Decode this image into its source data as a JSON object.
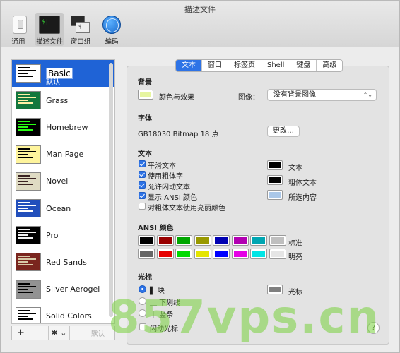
{
  "window": {
    "title": "描述文件"
  },
  "toolbar": {
    "items": [
      {
        "label": "通用",
        "icon": "general-icon"
      },
      {
        "label": "描述文件",
        "icon": "profiles-icon",
        "active": true
      },
      {
        "label": "窗口组",
        "icon": "window-groups-icon"
      },
      {
        "label": "编码",
        "icon": "encoding-icon"
      }
    ]
  },
  "profiles": {
    "items": [
      {
        "name": "Basic",
        "sub": "默认",
        "selected": true,
        "bg": "#ffffff",
        "fg": "#000000"
      },
      {
        "name": "Grass",
        "bg": "#13773d",
        "fg": "#fff0a5"
      },
      {
        "name": "Homebrew",
        "bg": "#000000",
        "fg": "#28fe14"
      },
      {
        "name": "Man Page",
        "bg": "#fef49c",
        "fg": "#000000"
      },
      {
        "name": "Novel",
        "bg": "#dfdbc3",
        "fg": "#3b2322"
      },
      {
        "name": "Ocean",
        "bg": "#224fbc",
        "fg": "#ffffff"
      },
      {
        "name": "Pro",
        "bg": "#000000",
        "fg": "#f2f2f2"
      },
      {
        "name": "Red Sands",
        "bg": "#7a251e",
        "fg": "#d7c9a7"
      },
      {
        "name": "Silver Aerogel",
        "bg": "#929292",
        "fg": "#000000"
      },
      {
        "name": "Solid Colors",
        "bg": "#ffffff",
        "fg": "#000000"
      }
    ],
    "toolbar": {
      "add": "+",
      "remove": "—",
      "gear": "✱ ⌄",
      "default": "默认"
    }
  },
  "tabs": [
    {
      "label": "文本",
      "active": true
    },
    {
      "label": "窗口"
    },
    {
      "label": "标签页"
    },
    {
      "label": "Shell"
    },
    {
      "label": "键盘"
    },
    {
      "label": "高级"
    }
  ],
  "background": {
    "title": "背景",
    "color_effect_label": "颜色与效果",
    "color": "#e6f5a0",
    "image_label": "图像：",
    "image_value": "没有背景图像"
  },
  "font": {
    "title": "字体",
    "value": "GB18030 Bitmap 18 点",
    "change_button": "更改…"
  },
  "text": {
    "title": "文本",
    "options": [
      {
        "label": "平滑文本",
        "checked": true
      },
      {
        "label": "使用粗体字",
        "checked": true
      },
      {
        "label": "允许闪动文本",
        "checked": true
      },
      {
        "label": "显示 ANSI 颜色",
        "checked": true
      },
      {
        "label": "对粗体文本使用亮丽颜色",
        "checked": false
      }
    ],
    "colors": [
      {
        "label": "文本",
        "color": "#000000"
      },
      {
        "label": "粗体文本",
        "color": "#000000"
      },
      {
        "label": "所选内容",
        "color": "#aac7e8"
      }
    ]
  },
  "ansi": {
    "title": "ANSI 颜色",
    "normal_label": "标准",
    "bright_label": "明亮",
    "normal": [
      "#000000",
      "#990000",
      "#00a600",
      "#999900",
      "#0000b2",
      "#b200b2",
      "#00a6b2",
      "#bfbfbf"
    ],
    "bright": [
      "#666666",
      "#e50000",
      "#00d900",
      "#e5e500",
      "#0000ff",
      "#e500e5",
      "#00e5e5",
      "#e5e5e5"
    ]
  },
  "cursor": {
    "title": "光标",
    "options": [
      {
        "label": "▌ 块",
        "checked": true
      },
      {
        "label": "＿ 下划线",
        "checked": false
      },
      {
        "label": "｜ 竖条",
        "checked": false
      }
    ],
    "blink_label": "闪动光标",
    "color_label": "光标",
    "color": "#7f7f7f"
  },
  "help": "?",
  "watermark": "857vps.cn"
}
